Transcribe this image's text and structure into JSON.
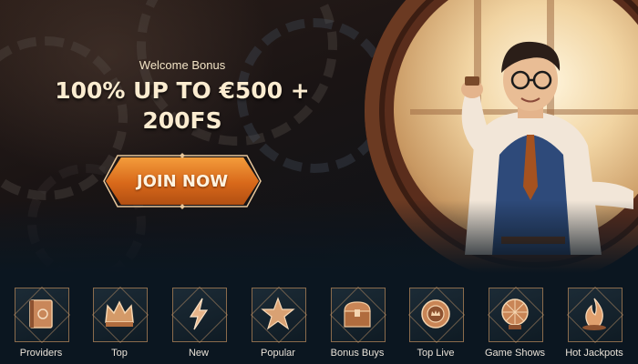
{
  "hero": {
    "bonus_label": "Welcome Bonus",
    "headline_line1": "100% UP TO €500 +",
    "headline_line2": "200FS",
    "cta_label": "JOIN NOW",
    "accent_color": "#e07a22"
  },
  "categories": [
    {
      "label": "Providers",
      "icon": "book-icon"
    },
    {
      "label": "Top",
      "icon": "crown-icon"
    },
    {
      "label": "New",
      "icon": "lightning-icon"
    },
    {
      "label": "Popular",
      "icon": "star-icon"
    },
    {
      "label": "Bonus Buys",
      "icon": "treasure-chest-icon"
    },
    {
      "label": "Top Live",
      "icon": "poker-chip-icon"
    },
    {
      "label": "Game Shows",
      "icon": "prize-wheel-icon"
    },
    {
      "label": "Hot Jackpots",
      "icon": "flame-icon"
    }
  ]
}
